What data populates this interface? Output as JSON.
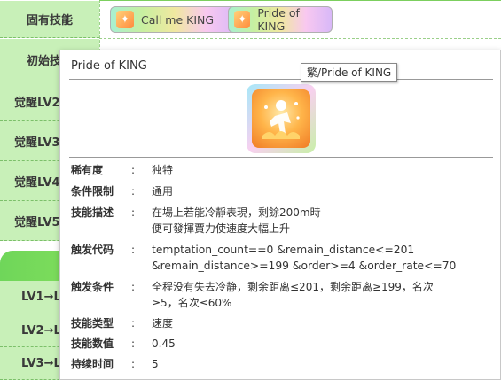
{
  "left_rows": [
    {
      "label": "固有技能"
    },
    {
      "label": "初始技"
    },
    {
      "label": "觉醒LV2"
    },
    {
      "label": "觉醒LV3"
    },
    {
      "label": "觉醒LV4"
    },
    {
      "label": "觉醒LV5"
    },
    {
      "label": "LV1→L"
    },
    {
      "label": "LV2→L"
    },
    {
      "label": "LV3→L"
    }
  ],
  "chips": [
    {
      "label": "Call me KING"
    },
    {
      "label": "Pride of KING"
    }
  ],
  "popup": {
    "title": "Pride of KING",
    "tooltip": "繁/Pride of KING",
    "rows": [
      {
        "label": "稀有度",
        "colon": ":",
        "value": "独特"
      },
      {
        "label": "条件限制",
        "colon": ":",
        "value": "通用"
      },
      {
        "label": "技能描述",
        "colon": ":",
        "value": "在場上若能冷靜表現，剩餘200m時\n便可發揮賈力使速度大幅上升"
      },
      {
        "label": "触发代码",
        "colon": ":",
        "value": "temptation_count==0 &remain_distance<=201\n&remain_distance>=199 &order>=4 &order_rate<=70"
      },
      {
        "label": "触发条件",
        "colon": ":",
        "value": "全程没有失去冷静，剩余距离≤201，剩余距离≥199，名次\n≥5，名次≤60%"
      },
      {
        "label": "技能类型",
        "colon": ":",
        "value": "速度"
      },
      {
        "label": "技能数值",
        "colon": ":",
        "value": "0.45"
      },
      {
        "label": "持续时间",
        "colon": ":",
        "value": "5"
      }
    ]
  },
  "colors": {
    "row_bg": "#c8f0b8",
    "band_green": "#6fd65a",
    "icon_orange": "#f07b25"
  }
}
